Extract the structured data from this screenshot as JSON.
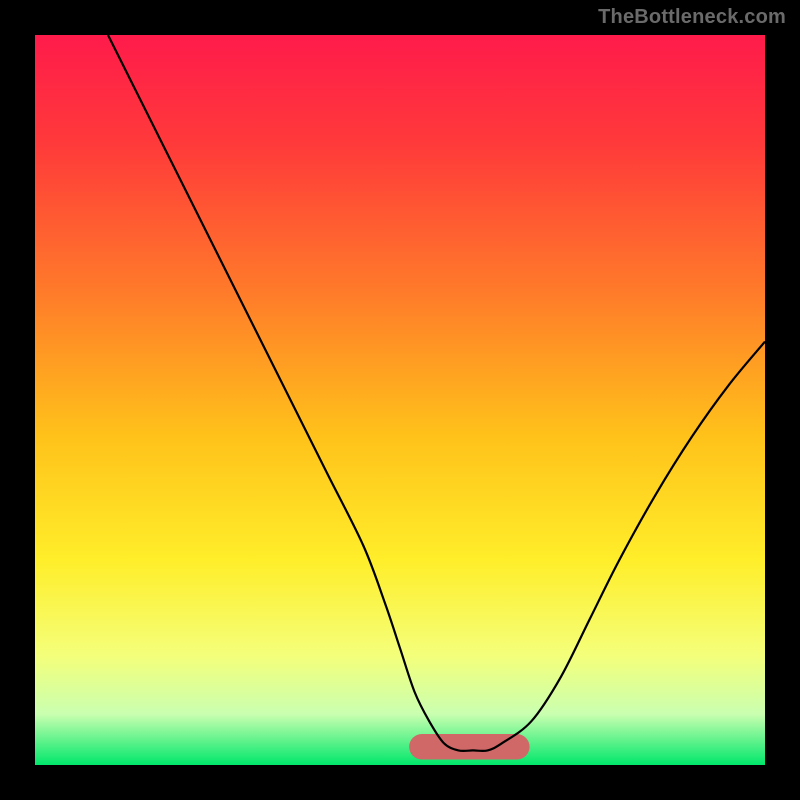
{
  "watermark": "TheBottleneck.com",
  "colors": {
    "frame": "#000000",
    "curve": "#000000",
    "band": "#d06868",
    "gradient_stops": [
      {
        "offset": 0.0,
        "color": "#ff1b4b"
      },
      {
        "offset": 0.15,
        "color": "#ff3a3a"
      },
      {
        "offset": 0.35,
        "color": "#ff7a2a"
      },
      {
        "offset": 0.55,
        "color": "#ffc21a"
      },
      {
        "offset": 0.72,
        "color": "#ffee2a"
      },
      {
        "offset": 0.85,
        "color": "#f4ff7a"
      },
      {
        "offset": 0.93,
        "color": "#caffb0"
      },
      {
        "offset": 1.0,
        "color": "#00e76b"
      }
    ]
  },
  "chart_data": {
    "type": "line",
    "title": "",
    "xlabel": "",
    "ylabel": "",
    "xlim": [
      0,
      100
    ],
    "ylim": [
      0,
      100
    ],
    "series": [
      {
        "name": "curve",
        "x": [
          10,
          15,
          20,
          25,
          30,
          35,
          40,
          45,
          48,
          50,
          52,
          54,
          56,
          58,
          60,
          62,
          64,
          68,
          72,
          76,
          80,
          85,
          90,
          95,
          100
        ],
        "values": [
          100,
          90,
          80,
          70,
          60,
          50,
          40,
          30,
          22,
          16,
          10,
          6,
          3,
          2,
          2,
          2,
          3,
          6,
          12,
          20,
          28,
          37,
          45,
          52,
          58
        ]
      }
    ],
    "optimal_band": {
      "x_start": 53,
      "x_end": 66,
      "y": 2.5,
      "height": 3.5
    }
  }
}
